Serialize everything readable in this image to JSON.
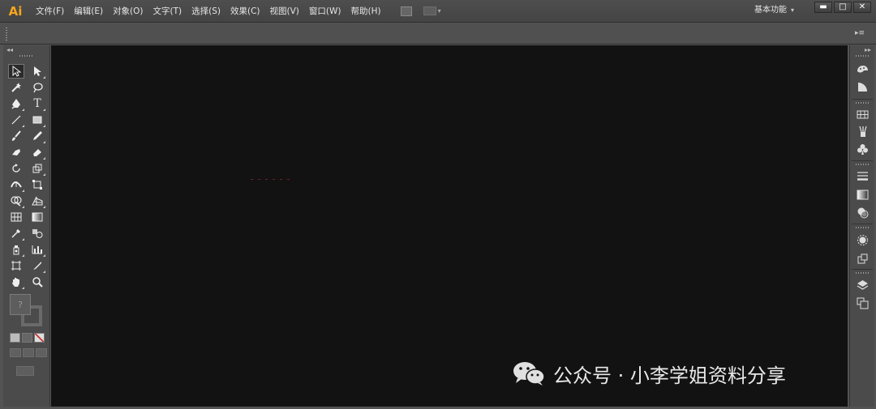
{
  "app": {
    "logo": "Ai",
    "menu": [
      "文件(F)",
      "编辑(E)",
      "对象(O)",
      "文字(T)",
      "选择(S)",
      "效果(C)",
      "视图(V)",
      "窗口(W)",
      "帮助(H)"
    ],
    "workspace_label": "基本功能",
    "window_buttons": [
      "▬",
      "□",
      "✕"
    ],
    "accent_color": "#f7a51c"
  },
  "toolbox": {
    "fill_swatch_mark": "?",
    "tools": [
      {
        "name": "selection-tool",
        "icon": "arrow-icon"
      },
      {
        "name": "direct-selection-tool",
        "icon": "direct-arrow-icon"
      },
      {
        "name": "magic-wand-tool",
        "icon": "magic-wand-icon"
      },
      {
        "name": "lasso-tool",
        "icon": "lasso-icon"
      },
      {
        "name": "pen-tool",
        "icon": "pen-icon"
      },
      {
        "name": "type-tool",
        "icon": "type-icon",
        "glyph": "T"
      },
      {
        "name": "line-tool",
        "icon": "line-icon"
      },
      {
        "name": "rectangle-tool",
        "icon": "rectangle-icon"
      },
      {
        "name": "paintbrush-tool",
        "icon": "brush-icon"
      },
      {
        "name": "pencil-tool",
        "icon": "pencil-icon"
      },
      {
        "name": "blob-brush-tool",
        "icon": "blob-brush-icon"
      },
      {
        "name": "eraser-tool",
        "icon": "eraser-icon"
      },
      {
        "name": "rotate-tool",
        "icon": "rotate-icon"
      },
      {
        "name": "scale-tool",
        "icon": "scale-icon"
      },
      {
        "name": "width-tool",
        "icon": "width-icon"
      },
      {
        "name": "free-transform-tool",
        "icon": "free-transform-icon"
      },
      {
        "name": "shape-builder-tool",
        "icon": "shape-builder-icon"
      },
      {
        "name": "perspective-grid-tool",
        "icon": "perspective-icon"
      },
      {
        "name": "mesh-tool",
        "icon": "mesh-icon"
      },
      {
        "name": "gradient-tool",
        "icon": "gradient-icon"
      },
      {
        "name": "eyedropper-tool",
        "icon": "eyedropper-icon"
      },
      {
        "name": "blend-tool",
        "icon": "blend-icon"
      },
      {
        "name": "symbol-sprayer-tool",
        "icon": "symbol-sprayer-icon"
      },
      {
        "name": "column-graph-tool",
        "icon": "column-graph-icon"
      },
      {
        "name": "artboard-tool",
        "icon": "artboard-icon"
      },
      {
        "name": "slice-tool",
        "icon": "slice-icon"
      },
      {
        "name": "hand-tool",
        "icon": "hand-icon"
      },
      {
        "name": "zoom-tool",
        "icon": "zoom-icon"
      }
    ]
  },
  "right_dock": {
    "icons": [
      "color-icon",
      "color-guide-icon",
      "swatches-icon",
      "brushes-icon",
      "symbols-icon",
      "stroke-icon",
      "gradient-panel-icon",
      "transparency-icon",
      "appearance-icon",
      "graphic-styles-icon",
      "layers-icon",
      "artboards-icon"
    ]
  },
  "watermark": {
    "text": "公众号 · 小李学姐资料分享",
    "icon": "wechat-icon"
  }
}
